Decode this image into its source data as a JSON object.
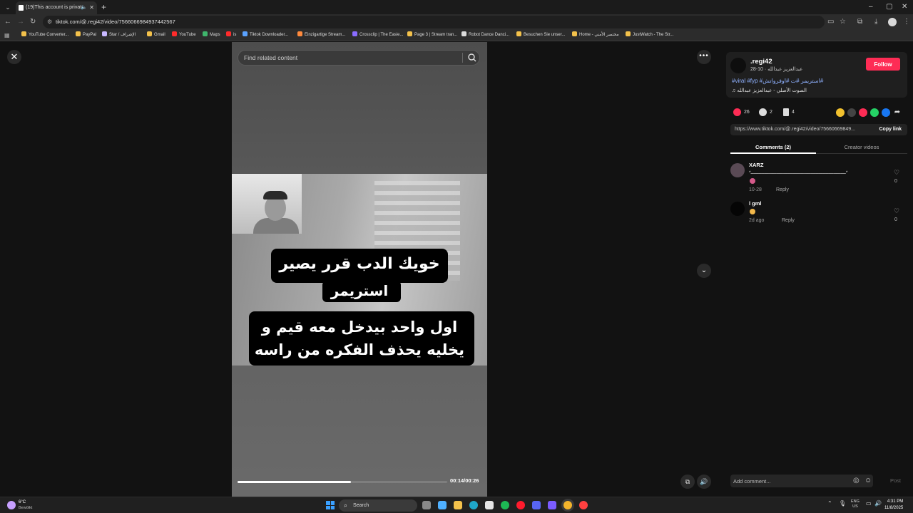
{
  "browser": {
    "tab_title": "(19)This account is private.",
    "url": "tiktok.com/@.regi42/video/7566066984937442567",
    "bookmarks": [
      "YouTube Converter...",
      "PayPal",
      "Star / الإشراف",
      "Gmail",
      "YouTube",
      "Maps",
      "is",
      "Tiktok Downloader...",
      "Einzigartige Stream...",
      "Crossclip | The Easie...",
      "Page 3 | Stream tran...",
      "Robot Dance Danci...",
      "Besuchen Sie unser...",
      "Home - مختصر الأمني",
      "JustWatch - The Str..."
    ]
  },
  "video": {
    "search_placeholder": "Find related content",
    "caption_line1": "خويك الدب قرر يصير",
    "caption_line2": "استريمر",
    "caption_line3": "اول واحد بيدخل معه قيم و",
    "caption_line4": "يخليه يحذف الفكره من راسه",
    "time": "00:14/00:26",
    "progress_fraction": 0.54
  },
  "author": {
    "username": ".regi42",
    "subtitle": "عبدالعزيز عبدالله · 10-28",
    "follow_label": "Follow",
    "hashtags": "#viral #fyp #استريمر #ت #اوفرواتش#",
    "music": "الصوت الأصلي - عبدالعزيز عبدالله"
  },
  "stats": {
    "likes": "26",
    "comments": "2",
    "saves": "4"
  },
  "share": {
    "link": "https://www.tiktok.com/@.regi42/video/75660669849...",
    "copy_label": "Copy link"
  },
  "side_tabs": {
    "comments": "Comments (2)",
    "creator": "Creator videos"
  },
  "comments": [
    {
      "user": "XARZ",
      "text": "*ــــــــــــــــــــــــــــــــــــــــــــــــــــــــــــــــــــــ*",
      "date": "10-28",
      "reply": "Reply",
      "likes": "0"
    },
    {
      "user": "l gml",
      "text": "",
      "date": "2d ago",
      "reply": "Reply",
      "likes": "0"
    }
  ],
  "add_comment_placeholder": "Add comment...",
  "post_label": "Post",
  "taskbar": {
    "temp": "6°C",
    "weather_desc": "Bewölkt",
    "search_label": "Search",
    "lang": "ENG",
    "region": "US",
    "time": "4:31 PM",
    "date": "11/8/2025"
  },
  "colors": {
    "follow": "#fe2c55",
    "hashtag": "#8fb1ff"
  }
}
